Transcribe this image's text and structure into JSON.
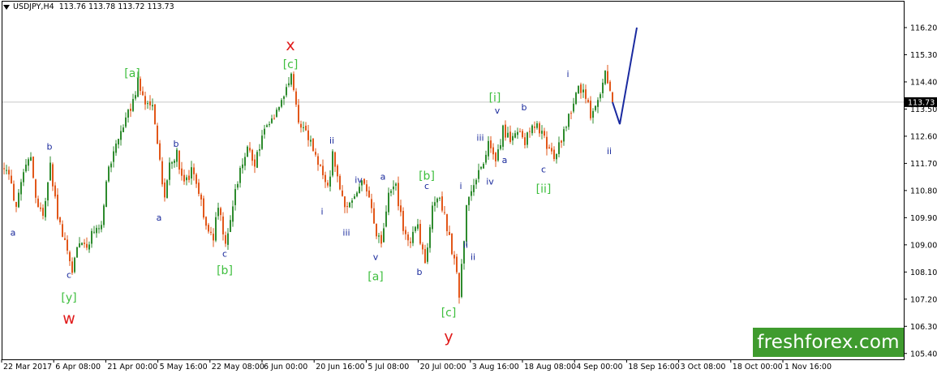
{
  "header": {
    "symbol_info": "USDJPY,H4",
    "ohlc": "113.76 113.78 113.72 113.73"
  },
  "watermark": "freshforex.com",
  "colors": {
    "bull_candle": "#2e8b2e",
    "bear_candle": "#e2571a",
    "projection": "#1a2aa0",
    "wave_label_blue": "#1a2a9c",
    "wave_label_green": "#3fbf3f",
    "wave_label_red": "#e01b1b",
    "price_tag": "#000000",
    "axis": "#000000",
    "background": "#ffffff"
  },
  "chart_data": {
    "type": "candlestick",
    "symbol": "USDJPY",
    "timeframe": "H4",
    "last_price": "113.73",
    "ylim": [
      105.0,
      116.8
    ],
    "y_ticks": [
      "116.20",
      "115.30",
      "114.40",
      "113.50",
      "112.60",
      "111.70",
      "110.80",
      "109.90",
      "109.00",
      "108.10",
      "107.20",
      "106.30",
      "105.40"
    ],
    "x_ticks": [
      "22 Mar 2017",
      "6 Apr 08:00",
      "21 Apr 00:00",
      "5 May 16:00",
      "22 May 08:00",
      "6 Jun 00:00",
      "20 Jun 16:00",
      "5 Jul 08:00",
      "20 Jul 00:00",
      "3 Aug 16:00",
      "18 Aug 08:00",
      "4 Sep 00:00",
      "18 Sep 16:00",
      "3 Oct 08:00",
      "18 Oct 00:00",
      "1 Nov 16:00"
    ],
    "price_path": [
      {
        "t": 0,
        "p": 111.6
      },
      {
        "t": 3,
        "p": 111.0
      },
      {
        "t": 5,
        "p": 110.2
      },
      {
        "t": 8,
        "p": 111.3
      },
      {
        "t": 11,
        "p": 112.0
      },
      {
        "t": 13,
        "p": 110.5
      },
      {
        "t": 16,
        "p": 110.0
      },
      {
        "t": 19,
        "p": 111.6
      },
      {
        "t": 22,
        "p": 110.0
      },
      {
        "t": 25,
        "p": 109.0
      },
      {
        "t": 28,
        "p": 108.2
      },
      {
        "t": 31,
        "p": 109.2
      },
      {
        "t": 34,
        "p": 108.9
      },
      {
        "t": 37,
        "p": 109.5
      },
      {
        "t": 40,
        "p": 109.8
      },
      {
        "t": 43,
        "p": 111.5
      },
      {
        "t": 46,
        "p": 112.3
      },
      {
        "t": 49,
        "p": 112.8
      },
      {
        "t": 52,
        "p": 113.6
      },
      {
        "t": 55,
        "p": 114.4
      },
      {
        "t": 58,
        "p": 113.7
      },
      {
        "t": 61,
        "p": 113.6
      },
      {
        "t": 64,
        "p": 111.8
      },
      {
        "t": 66,
        "p": 110.5
      },
      {
        "t": 68,
        "p": 111.7
      },
      {
        "t": 71,
        "p": 112.0
      },
      {
        "t": 74,
        "p": 111.0
      },
      {
        "t": 77,
        "p": 111.4
      },
      {
        "t": 80,
        "p": 110.7
      },
      {
        "t": 83,
        "p": 109.6
      },
      {
        "t": 86,
        "p": 109.3
      },
      {
        "t": 88,
        "p": 110.3
      },
      {
        "t": 91,
        "p": 109.0
      },
      {
        "t": 94,
        "p": 110.3
      },
      {
        "t": 97,
        "p": 111.6
      },
      {
        "t": 100,
        "p": 112.2
      },
      {
        "t": 103,
        "p": 111.7
      },
      {
        "t": 106,
        "p": 112.6
      },
      {
        "t": 109,
        "p": 113.0
      },
      {
        "t": 112,
        "p": 113.5
      },
      {
        "t": 115,
        "p": 114.0
      },
      {
        "t": 118,
        "p": 114.5
      },
      {
        "t": 121,
        "p": 113.2
      },
      {
        "t": 124,
        "p": 112.7
      },
      {
        "t": 127,
        "p": 112.2
      },
      {
        "t": 130,
        "p": 111.5
      },
      {
        "t": 133,
        "p": 110.8
      },
      {
        "t": 135,
        "p": 112.0
      },
      {
        "t": 138,
        "p": 110.7
      },
      {
        "t": 141,
        "p": 110.2
      },
      {
        "t": 144,
        "p": 110.6
      },
      {
        "t": 147,
        "p": 111.2
      },
      {
        "t": 150,
        "p": 110.5
      },
      {
        "t": 153,
        "p": 109.3
      },
      {
        "t": 155,
        "p": 109.0
      },
      {
        "t": 158,
        "p": 110.6
      },
      {
        "t": 161,
        "p": 110.9
      },
      {
        "t": 164,
        "p": 109.5
      },
      {
        "t": 167,
        "p": 109.1
      },
      {
        "t": 170,
        "p": 109.6
      },
      {
        "t": 173,
        "p": 108.3
      },
      {
        "t": 176,
        "p": 110.3
      },
      {
        "t": 179,
        "p": 110.6
      },
      {
        "t": 182,
        "p": 109.6
      },
      {
        "t": 185,
        "p": 108.5
      },
      {
        "t": 187,
        "p": 107.4
      },
      {
        "t": 190,
        "p": 110.2
      },
      {
        "t": 193,
        "p": 111.0
      },
      {
        "t": 196,
        "p": 111.6
      },
      {
        "t": 199,
        "p": 112.3
      },
      {
        "t": 202,
        "p": 111.6
      },
      {
        "t": 205,
        "p": 112.8
      },
      {
        "t": 208,
        "p": 112.5
      },
      {
        "t": 211,
        "p": 112.9
      },
      {
        "t": 214,
        "p": 112.4
      },
      {
        "t": 217,
        "p": 113.0
      },
      {
        "t": 220,
        "p": 112.8
      },
      {
        "t": 223,
        "p": 112.3
      },
      {
        "t": 226,
        "p": 111.9
      },
      {
        "t": 229,
        "p": 112.5
      },
      {
        "t": 232,
        "p": 113.2
      },
      {
        "t": 235,
        "p": 114.0
      },
      {
        "t": 238,
        "p": 114.3
      },
      {
        "t": 241,
        "p": 113.3
      },
      {
        "t": 244,
        "p": 113.9
      },
      {
        "t": 247,
        "p": 114.6
      },
      {
        "t": 250,
        "p": 113.7
      }
    ],
    "projection": [
      {
        "x_after_last": 0,
        "p": 113.73
      },
      {
        "x_after_last": 3,
        "p": 113.0
      },
      {
        "x_after_last": 10,
        "p": 116.2
      }
    ],
    "wave_labels": {
      "blue": [
        {
          "text": "a",
          "t": 4,
          "p": 109.6,
          "pos": "below"
        },
        {
          "text": "b",
          "t": 19,
          "p": 112.1,
          "pos": "above"
        },
        {
          "text": "c",
          "t": 27,
          "p": 108.2,
          "pos": "below"
        },
        {
          "text": "a",
          "t": 64,
          "p": 110.1,
          "pos": "below"
        },
        {
          "text": "b",
          "t": 71,
          "p": 112.2,
          "pos": "above"
        },
        {
          "text": "c",
          "t": 91,
          "p": 108.9,
          "pos": "below"
        },
        {
          "text": "i",
          "t": 131,
          "p": 110.3,
          "pos": "below"
        },
        {
          "text": "ii",
          "t": 135,
          "p": 112.3,
          "pos": "above"
        },
        {
          "text": "iii",
          "t": 141,
          "p": 109.6,
          "pos": "below"
        },
        {
          "text": "iv",
          "t": 146,
          "p": 111.0,
          "pos": "above"
        },
        {
          "text": "v",
          "t": 153,
          "p": 108.8,
          "pos": "below"
        },
        {
          "text": "a",
          "t": 156,
          "p": 111.1,
          "pos": "above"
        },
        {
          "text": "b",
          "t": 171,
          "p": 108.3,
          "pos": "below"
        },
        {
          "text": "c",
          "t": 174,
          "p": 110.8,
          "pos": "above"
        },
        {
          "text": "i",
          "t": 188,
          "p": 110.8,
          "pos": "above"
        },
        {
          "text": "ii",
          "t": 190,
          "p": 109.2,
          "pos": "below"
        },
        {
          "text": "ii",
          "t": 193,
          "p": 108.8,
          "pos": "below"
        },
        {
          "text": "iii",
          "t": 196,
          "p": 112.4,
          "pos": "above"
        },
        {
          "text": "iv",
          "t": 200,
          "p": 111.3,
          "pos": "below"
        },
        {
          "text": "v",
          "t": 203,
          "p": 113.3,
          "pos": "above"
        },
        {
          "text": "a",
          "t": 206,
          "p": 112.0,
          "pos": "below"
        },
        {
          "text": "b",
          "t": 214,
          "p": 113.4,
          "pos": "above"
        },
        {
          "text": "c",
          "t": 222,
          "p": 111.7,
          "pos": "below"
        },
        {
          "text": "i",
          "t": 232,
          "p": 114.5,
          "pos": "above"
        },
        {
          "text": "ii",
          "t": 249,
          "p": 112.3,
          "pos": "below"
        }
      ],
      "green": [
        {
          "text": "[y]",
          "t": 27,
          "p": 107.5,
          "pos": "below"
        },
        {
          "text": "[a]",
          "t": 53,
          "p": 114.5,
          "pos": "above"
        },
        {
          "text": "[b]",
          "t": 91,
          "p": 108.4,
          "pos": "below"
        },
        {
          "text": "[c]",
          "t": 118,
          "p": 114.8,
          "pos": "above"
        },
        {
          "text": "[a]",
          "t": 153,
          "p": 108.2,
          "pos": "below"
        },
        {
          "text": "[b]",
          "t": 174,
          "p": 111.1,
          "pos": "above"
        },
        {
          "text": "[c]",
          "t": 183,
          "p": 107.0,
          "pos": "below"
        },
        {
          "text": "[i]",
          "t": 202,
          "p": 113.7,
          "pos": "above"
        },
        {
          "text": "[ii]",
          "t": 222,
          "p": 111.1,
          "pos": "below"
        }
      ],
      "red": [
        {
          "text": "w",
          "t": 27,
          "p": 106.9,
          "pos": "below"
        },
        {
          "text": "x",
          "t": 118,
          "p": 115.4,
          "pos": "above"
        },
        {
          "text": "y",
          "t": 183,
          "p": 106.3,
          "pos": "below"
        }
      ]
    }
  }
}
